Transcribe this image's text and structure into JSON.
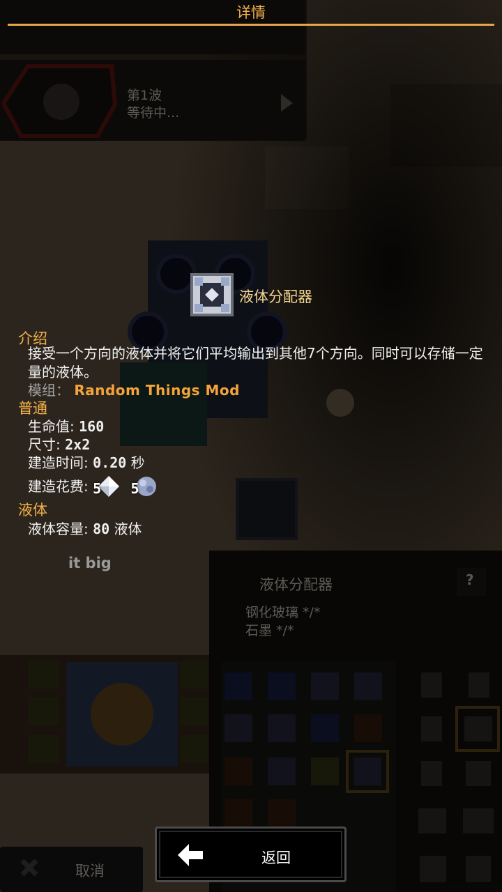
{
  "header": {
    "title": "详情"
  },
  "block": {
    "name": "液体分配器"
  },
  "sections": {
    "intro": "介绍",
    "general": "普通",
    "liquid": "液体"
  },
  "description": "接受一个方向的液体并将它们平均输出到其他7个方向。同时可以存储一定量的液体。",
  "mod": {
    "label": "模组：",
    "name": "Random Things Mod"
  },
  "stats": {
    "health_label": "生命值:",
    "health_value": "160",
    "size_label": "尺寸:",
    "size_value": "2x2",
    "build_time_label": "建造时间:",
    "build_time_value": "0.20",
    "build_time_unit": "秒",
    "build_cost_label": "建造花费:",
    "cost_items": [
      {
        "amount": "5",
        "icon": "metaglass-icon"
      },
      {
        "amount": "5",
        "icon": "graphite-icon"
      }
    ],
    "liquid_capacity_label": "液体容量:",
    "liquid_capacity_value": "80",
    "liquid_capacity_unit": "液体"
  },
  "background": {
    "wave_title": "第1波",
    "wave_status": "等待中...",
    "hint": "it big",
    "placement_name": "液体分配器",
    "req_1": "钢化玻璃 */*",
    "req_2": "石墨 */*",
    "help": "?",
    "cancel": "取消"
  },
  "back_button": {
    "label": "返回"
  },
  "colors": {
    "accent": "#f5b14a",
    "mod": "#f5a43a"
  }
}
